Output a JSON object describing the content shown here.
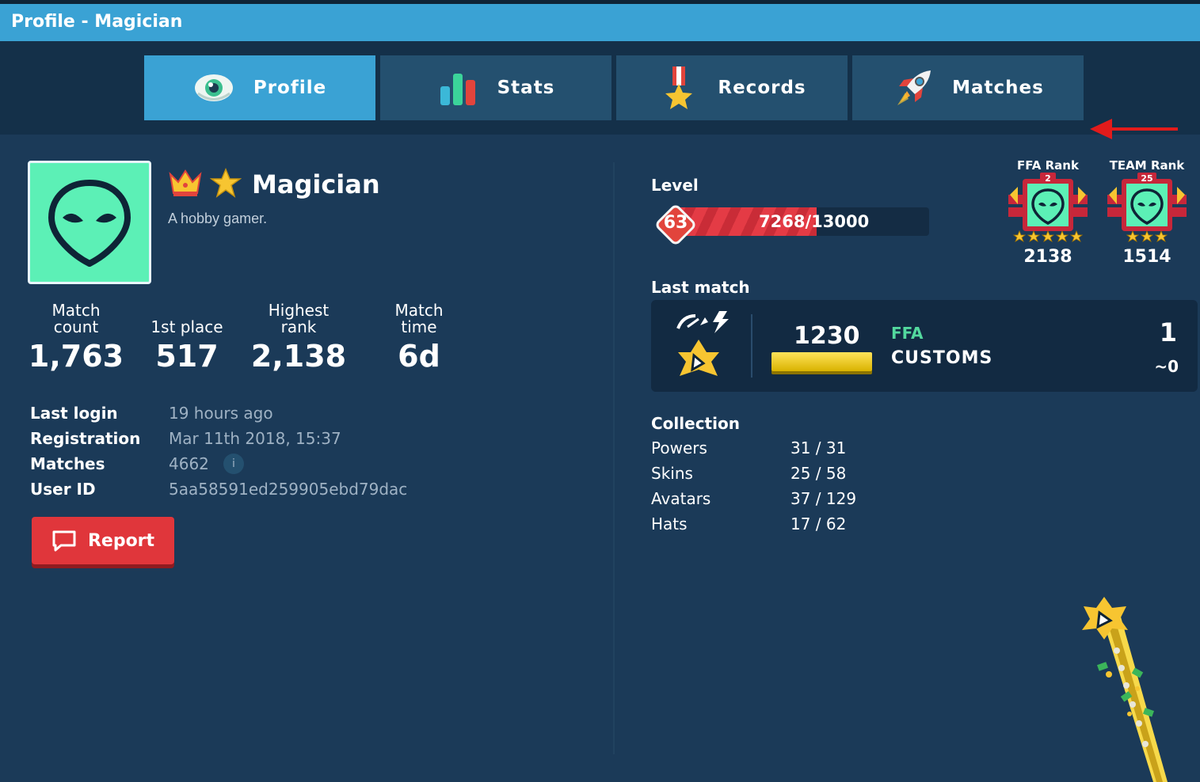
{
  "window": {
    "title": "Profile - Magician"
  },
  "tabs": [
    {
      "label": "Profile",
      "icon": "eye-icon",
      "active": true
    },
    {
      "label": "Stats",
      "icon": "bar-chart-icon",
      "active": false
    },
    {
      "label": "Records",
      "icon": "medal-icon",
      "active": false
    },
    {
      "label": "Matches",
      "icon": "rocket-icon",
      "active": false
    }
  ],
  "profile": {
    "name": "Magician",
    "bio": "A hobby gamer.",
    "avatar_icon": "alien-icon",
    "badges": [
      "crown-icon",
      "star-icon"
    ]
  },
  "stats": [
    {
      "label": "Match count",
      "value": "1,763"
    },
    {
      "label": "1st place",
      "value": "517"
    },
    {
      "label": "Highest rank",
      "value": "2,138"
    },
    {
      "label": "Match time",
      "value": "6d"
    }
  ],
  "info": {
    "last_login": {
      "label": "Last login",
      "value": "19 hours ago"
    },
    "registration": {
      "label": "Registration",
      "value": "Mar 11th 2018, 15:37"
    },
    "matches": {
      "label": "Matches",
      "value": "4662",
      "info_glyph": "i"
    },
    "user_id": {
      "label": "User ID",
      "value": "5aa58591ed259905ebd79dac"
    }
  },
  "report_button": {
    "label": "Report"
  },
  "level": {
    "title": "Level",
    "value": "63",
    "xp_text": "7268/13000",
    "progress": 0.559
  },
  "ranks": [
    {
      "label": "FFA Rank",
      "badge": "2",
      "value": "2138",
      "stars": 5
    },
    {
      "label": "TEAM Rank",
      "badge": "25",
      "value": "1514",
      "stars": 3
    }
  ],
  "last_match": {
    "title": "Last match",
    "score": "1230",
    "mode": "FFA",
    "submode": "CUSTOMS",
    "place": "1",
    "delta": "~0"
  },
  "collection": {
    "title": "Collection",
    "items": [
      {
        "label": "Powers",
        "value": "31 / 31"
      },
      {
        "label": "Skins",
        "value": "25 / 58"
      },
      {
        "label": "Avatars",
        "value": "37 / 129"
      },
      {
        "label": "Hats",
        "value": "17 / 62"
      }
    ]
  },
  "colors": {
    "accent": "#3aa2d4",
    "background": "#1b3a58",
    "avatar": "#5cf0b6",
    "report": "#e0363b",
    "level_bar": "#e43b45",
    "mode": "#53d89e"
  }
}
